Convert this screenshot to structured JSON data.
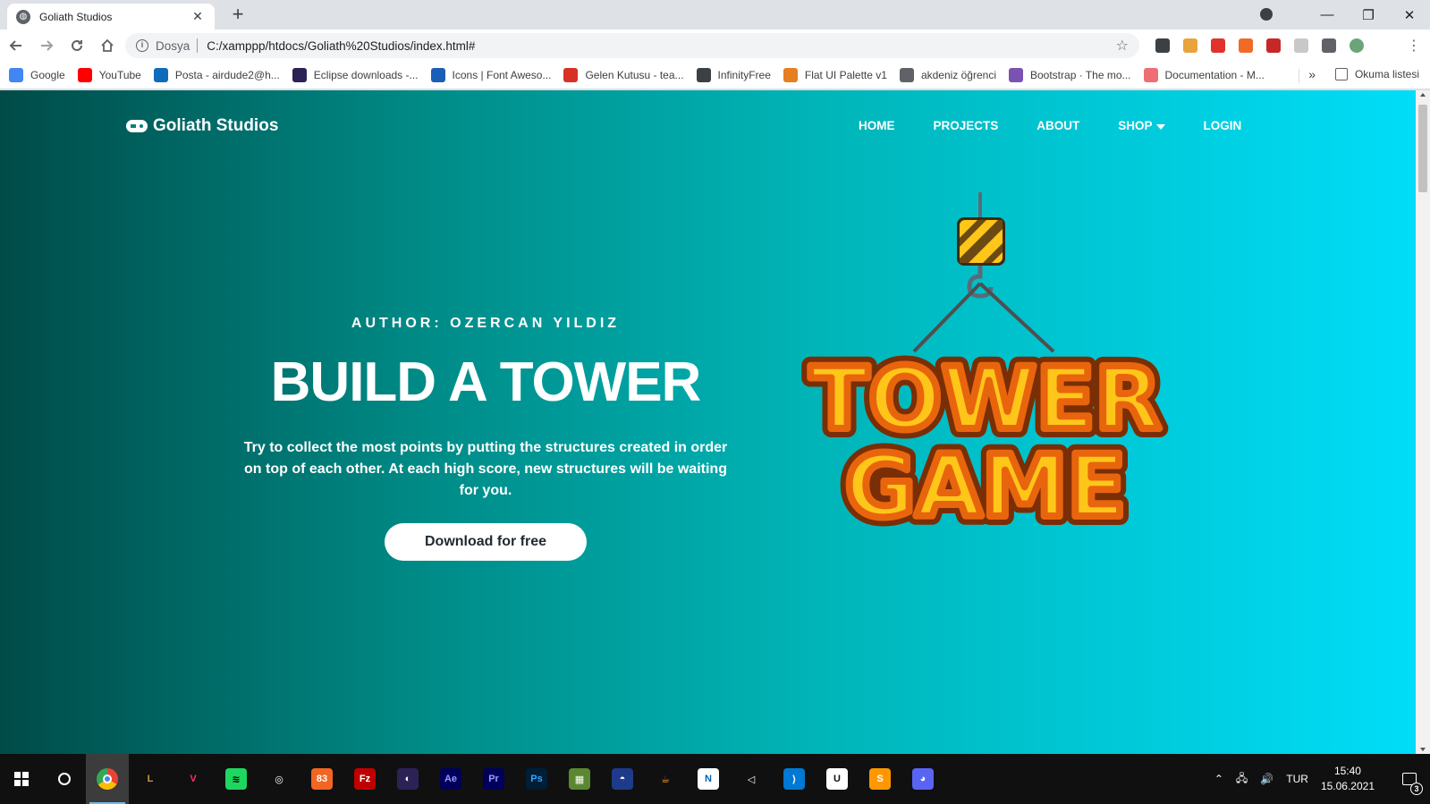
{
  "browser": {
    "tab_title": "Goliath Studios",
    "tab_close": "✕",
    "new_tab": "+",
    "window_controls": [
      "—",
      "❐",
      "✕"
    ],
    "security_label": "Dosya",
    "url": "C:/xamppp/htdocs/Goliath%20Studios/index.html#",
    "extensions": [
      {
        "name": "sync-extension-icon",
        "color": "#3c4043"
      },
      {
        "name": "glasses-extension-icon",
        "color": "#e8a33d"
      },
      {
        "name": "adblock-plus-icon",
        "color": "#e0332d"
      },
      {
        "name": "fire-extension-icon",
        "color": "#f06b25"
      },
      {
        "name": "chart-extension-icon",
        "color": "#c62828"
      },
      {
        "name": "shield-extension-icon",
        "color": "#c8c8c8"
      },
      {
        "name": "puzzle-extensions-icon",
        "color": "#5f6368"
      },
      {
        "name": "profile-avatar-icon",
        "color": "#6aa57a"
      }
    ],
    "bookmarks": [
      {
        "label": "Google",
        "icon": "google-icon",
        "color": "#4285f4"
      },
      {
        "label": "YouTube",
        "icon": "youtube-icon",
        "color": "#ff0000"
      },
      {
        "label": "Posta - airdude2@h...",
        "icon": "outlook-icon",
        "color": "#0f6cbd"
      },
      {
        "label": "Eclipse downloads -...",
        "icon": "eclipse-icon",
        "color": "#2c2255"
      },
      {
        "label": "Icons | Font Aweso...",
        "icon": "font-awesome-icon",
        "color": "#1b5eb8"
      },
      {
        "label": "Gelen Kutusu - tea...",
        "icon": "gmail-icon",
        "color": "#d93025"
      },
      {
        "label": "InfinityFree",
        "icon": "infinity-icon",
        "color": "#3c4043"
      },
      {
        "label": "Flat UI Palette v1",
        "icon": "palette-icon",
        "color": "#e67e22"
      },
      {
        "label": "akdeniz öğrenci",
        "icon": "globe-icon",
        "color": "#5f6368"
      },
      {
        "label": "Bootstrap · The mo...",
        "icon": "bootstrap-icon",
        "color": "#7952b3"
      },
      {
        "label": "Documentation - M...",
        "icon": "materialize-icon",
        "color": "#ee6e73"
      }
    ],
    "bookmarks_more": "»",
    "reading_list": "Okuma listesi"
  },
  "site": {
    "brand": "Goliath Studios",
    "nav": {
      "home": "HOME",
      "projects": "PROJECTS",
      "about": "ABOUT",
      "shop": "SHOP",
      "login": "LOGIN"
    },
    "hero": {
      "author": "AUTHOR: OZERCAN YILDIZ",
      "title": "BUILD A TOWER",
      "description": "Try to collect the most points by putting the structures created in order on top of each other. At each high score, new structures will be waiting for you.",
      "button": "Download for free"
    },
    "logo": {
      "line1": "TOWER",
      "line2": "GAME"
    },
    "colors": {
      "gradient_start": "#004b48",
      "gradient_end": "#00ddf8",
      "logo_fill": "#ffc61a",
      "logo_outline": "#e8650e"
    }
  },
  "taskbar": {
    "apps": [
      {
        "name": "chrome-taskbar-icon",
        "label": "",
        "color": "#ffffff",
        "bg": "transparent",
        "active": true
      },
      {
        "name": "league-taskbar-icon",
        "label": "L",
        "color": "#c89b3c",
        "bg": "transparent"
      },
      {
        "name": "app-taskbar-icon",
        "label": "V",
        "color": "#ff2e63",
        "bg": "transparent"
      },
      {
        "name": "spotify-taskbar-icon",
        "label": "≋",
        "color": "#000000",
        "bg": "#1ed760"
      },
      {
        "name": "obs-taskbar-icon",
        "label": "◎",
        "color": "#ffffff",
        "bg": "transparent"
      },
      {
        "name": "game-taskbar-icon",
        "label": "83",
        "color": "#ffffff",
        "bg": "#f26522"
      },
      {
        "name": "filezilla-taskbar-icon",
        "label": "Fz",
        "color": "#ffffff",
        "bg": "#bf0000"
      },
      {
        "name": "eclipse-taskbar-icon",
        "label": "◐",
        "color": "#ffffff",
        "bg": "#2c2255"
      },
      {
        "name": "after-effects-taskbar-icon",
        "label": "Ae",
        "color": "#9999ff",
        "bg": "#00005b"
      },
      {
        "name": "premiere-taskbar-icon",
        "label": "Pr",
        "color": "#9999ff",
        "bg": "#00005b"
      },
      {
        "name": "photoshop-taskbar-icon",
        "label": "Ps",
        "color": "#31a8ff",
        "bg": "#001e36"
      },
      {
        "name": "minecraft-taskbar-icon",
        "label": "▦",
        "color": "#ffffff",
        "bg": "#5b8731"
      },
      {
        "name": "app2-taskbar-icon",
        "label": "◓",
        "color": "#ffffff",
        "bg": "#1e3a8a"
      },
      {
        "name": "java-taskbar-icon",
        "label": "☕",
        "color": "#f89820",
        "bg": "transparent"
      },
      {
        "name": "app3-taskbar-icon",
        "label": "N",
        "color": "#0063b1",
        "bg": "#ffffff"
      },
      {
        "name": "unity-taskbar-icon",
        "label": "◁",
        "color": "#ffffff",
        "bg": "transparent"
      },
      {
        "name": "vscode-taskbar-icon",
        "label": "⟩",
        "color": "#ffffff",
        "bg": "#0078d4"
      },
      {
        "name": "unreal-taskbar-icon",
        "label": "U",
        "color": "#101010",
        "bg": "#ffffff"
      },
      {
        "name": "sublime-taskbar-icon",
        "label": "S",
        "color": "#ffffff",
        "bg": "#ff9800"
      },
      {
        "name": "discord-taskbar-icon",
        "label": "◕",
        "color": "#ffffff",
        "bg": "#5865f2"
      }
    ],
    "language": "TUR",
    "time": "15:40",
    "date": "15.06.2021",
    "notifications": "3"
  }
}
